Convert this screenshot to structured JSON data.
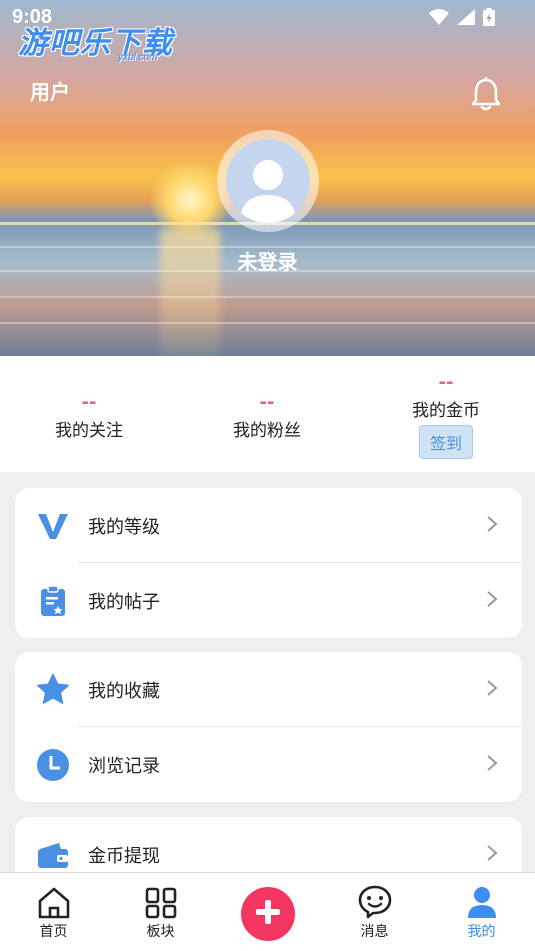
{
  "status_bar": {
    "time": "9:08"
  },
  "watermark": {
    "text": "游吧乐下载",
    "sub": "yxbl.com"
  },
  "header": {
    "title": "用户"
  },
  "profile": {
    "username": "未登录"
  },
  "stats": {
    "following": {
      "value": "--",
      "label": "我的关注"
    },
    "fans": {
      "value": "--",
      "label": "我的粉丝"
    },
    "coins": {
      "value": "--",
      "label": "我的金币",
      "sign_in_label": "签到"
    }
  },
  "menu_groups": [
    {
      "items": [
        {
          "label": "我的等级",
          "icon": "level-v-icon"
        },
        {
          "label": "我的帖子",
          "icon": "clipboard-icon"
        }
      ]
    },
    {
      "items": [
        {
          "label": "我的收藏",
          "icon": "star-icon"
        },
        {
          "label": "浏览记录",
          "icon": "clock-icon"
        }
      ]
    },
    {
      "items": [
        {
          "label": "金币提现",
          "icon": "wallet-icon"
        }
      ]
    }
  ],
  "tabs": [
    {
      "label": "首页",
      "icon": "home-icon"
    },
    {
      "label": "板块",
      "icon": "grid-icon"
    },
    {
      "label": "",
      "icon": "plus-icon"
    },
    {
      "label": "消息",
      "icon": "message-icon"
    },
    {
      "label": "我的",
      "icon": "user-icon"
    }
  ],
  "colors": {
    "accent": "#3d8ef0",
    "pink": "#ee5b86",
    "fab": "#f2365f",
    "icon_blue": "#4a90e2"
  }
}
